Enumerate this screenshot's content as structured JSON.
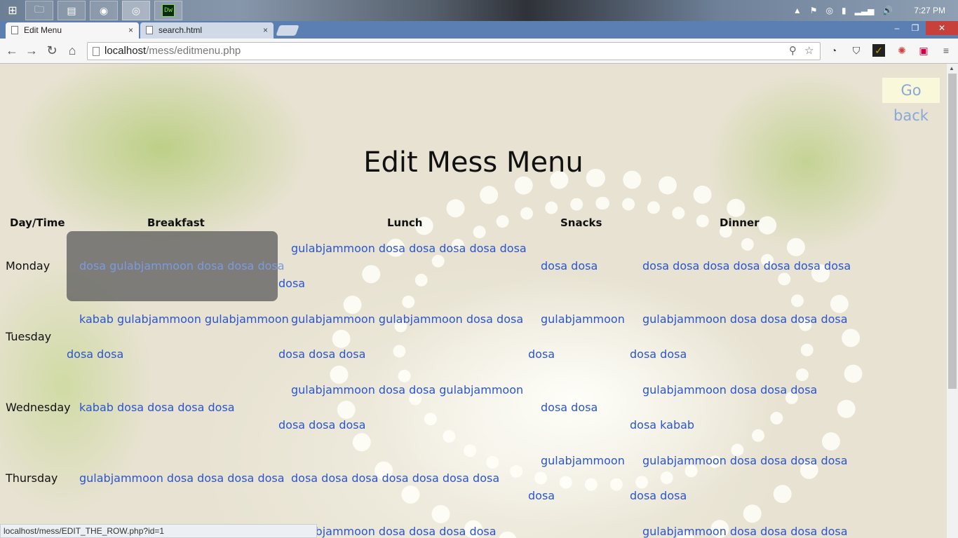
{
  "taskbar": {
    "start_icon": "windows-logo-icon",
    "apps": [
      "file-explorer-icon",
      "sticky-notes-icon",
      "firefox-icon",
      "chrome-icon",
      "dreamweaver-icon"
    ],
    "dreamweaver_label": "Dw",
    "clock": "7:27 PM"
  },
  "browser": {
    "tabs": [
      {
        "label": "Edit Menu",
        "close": "×"
      },
      {
        "label": "search.html",
        "close": "×"
      }
    ],
    "window_controls": {
      "minimize": "–",
      "maximize": "❐",
      "close": "✕"
    },
    "address": {
      "host": "localhost",
      "path": "/mess/editmenu.php"
    },
    "status_url": "localhost/mess/EDIT_THE_ROW.php?id=1"
  },
  "page": {
    "go_back": "Go back",
    "title": "Edit Mess Menu",
    "columns": [
      "Day/Time",
      "Breakfast",
      "Lunch",
      "Snacks",
      "Dinner"
    ],
    "rows": [
      {
        "day": "Monday",
        "breakfast": [
          "dosa gulabjammoon dosa dosa dosa"
        ],
        "lunch": [
          "gulabjammoon dosa dosa dosa dosa dosa",
          "dosa"
        ],
        "snacks": [
          "dosa dosa"
        ],
        "dinner": [
          "dosa dosa dosa dosa dosa dosa dosa"
        ]
      },
      {
        "day": "Tuesday",
        "breakfast": [
          "kabab gulabjammoon gulabjammoon",
          "dosa dosa"
        ],
        "lunch": [
          "gulabjammoon gulabjammoon dosa dosa",
          "dosa dosa dosa"
        ],
        "snacks": [
          "gulabjammoon",
          "dosa"
        ],
        "dinner": [
          "gulabjammoon dosa dosa dosa dosa",
          "dosa dosa"
        ]
      },
      {
        "day": "Wednesday",
        "breakfast": [
          "kabab dosa dosa dosa dosa"
        ],
        "lunch": [
          "gulabjammoon dosa dosa gulabjammoon",
          "dosa dosa dosa"
        ],
        "snacks": [
          "dosa dosa"
        ],
        "dinner": [
          "gulabjammoon dosa dosa dosa",
          "dosa kabab"
        ]
      },
      {
        "day": "Thursday",
        "breakfast": [
          "gulabjammoon dosa dosa dosa dosa"
        ],
        "lunch": [
          "dosa dosa dosa dosa dosa dosa dosa"
        ],
        "snacks": [
          "gulabjammoon",
          "dosa"
        ],
        "dinner": [
          "gulabjammoon dosa dosa dosa dosa",
          "dosa dosa"
        ]
      },
      {
        "day": "",
        "breakfast": [],
        "lunch": [
          "gulabjammoon dosa dosa dosa dosa"
        ],
        "snacks": [],
        "dinner": [
          "gulabjammoon dosa dosa dosa dosa"
        ]
      }
    ]
  }
}
